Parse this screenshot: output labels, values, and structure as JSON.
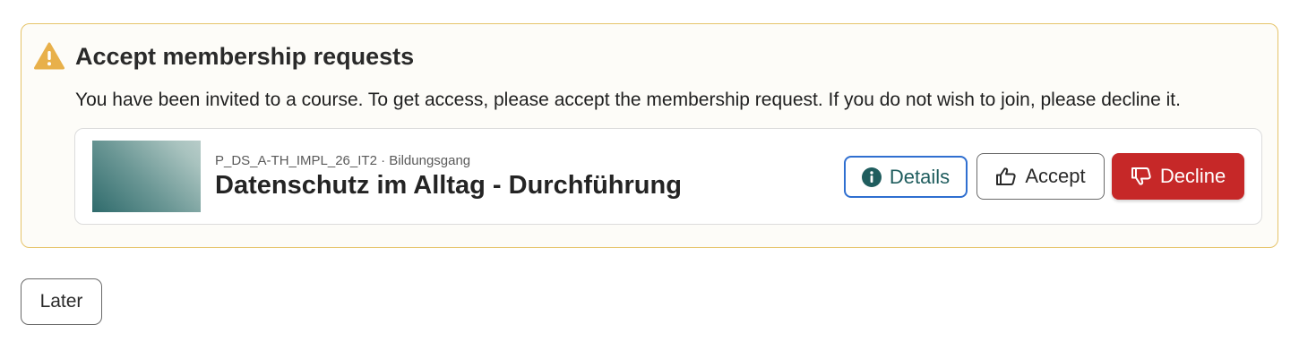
{
  "alert": {
    "title": "Accept membership requests",
    "message": "You have been invited to a course. To get access, please accept the membership request. If you do not wish to join, please decline it.",
    "icon": "warning-triangle-icon",
    "border_color": "#e6c46a",
    "icon_color": "#e8b04a"
  },
  "course": {
    "meta": "P_DS_A-TH_IMPL_26_IT2 · Bildungsgang",
    "name": "Datenschutz im Alltag - Durchführung",
    "actions": {
      "details_label": "Details",
      "details_icon": "info-circle-icon",
      "accept_label": "Accept",
      "accept_icon": "thumbs-up-icon",
      "decline_label": "Decline",
      "decline_icon": "thumbs-down-icon",
      "decline_color": "#c62828",
      "details_border_color": "#2f6fd0"
    }
  },
  "footer": {
    "later_label": "Later"
  }
}
